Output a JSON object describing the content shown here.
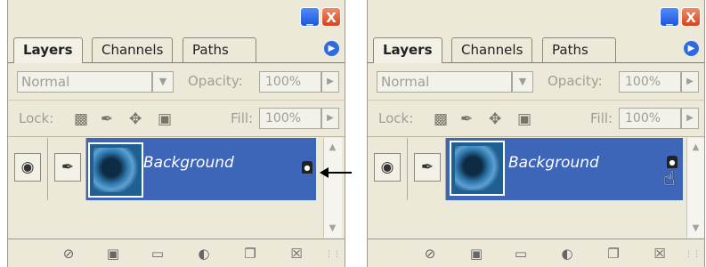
{
  "panels": [
    {
      "window_buttons": {
        "minimize": "_",
        "close": "X"
      },
      "tabs": [
        "Layers",
        "Channels",
        "Paths"
      ],
      "active_tab": "Layers",
      "blend_mode": "Normal",
      "opacity_label": "Opacity:",
      "opacity_value": "100%",
      "lock_label": "Lock:",
      "fill_label": "Fill:",
      "fill_value": "100%",
      "layers": [
        {
          "name": "Background",
          "visible": true,
          "locked": true
        }
      ]
    },
    {
      "window_buttons": {
        "minimize": "_",
        "close": "X"
      },
      "tabs": [
        "Layers",
        "Channels",
        "Paths"
      ],
      "active_tab": "Layers",
      "blend_mode": "Normal",
      "opacity_label": "Opacity:",
      "opacity_value": "100%",
      "lock_label": "Lock:",
      "fill_label": "Fill:",
      "fill_value": "100%",
      "layers": [
        {
          "name": "Background",
          "visible": true,
          "locked": true
        }
      ]
    }
  ],
  "colors": {
    "selected_layer": "#3d65b8",
    "panel_bg": "#ece9d8"
  },
  "icons": {
    "bottom_bar": [
      "link-layers-icon",
      "add-mask-icon",
      "new-group-icon",
      "adjustment-layer-icon",
      "new-layer-icon",
      "delete-layer-icon"
    ],
    "lock": [
      "lock-transparent-icon",
      "lock-image-icon",
      "lock-position-icon",
      "lock-all-icon"
    ]
  }
}
